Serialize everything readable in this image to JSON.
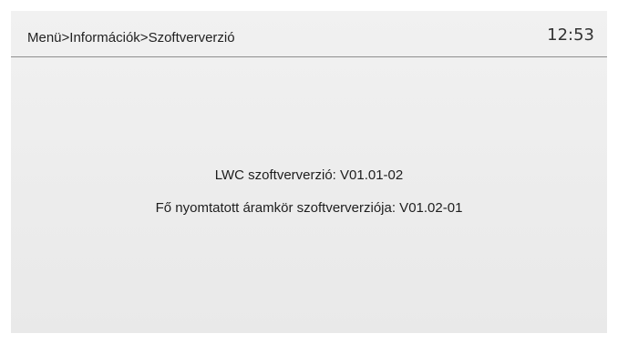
{
  "header": {
    "breadcrumb": "Menü>Információk>Szoftververzió",
    "time": "12:53"
  },
  "main": {
    "lwc_version": "LWC szoftververzió: V01.01-02",
    "pcb_version": "Fő nyomtatott áramkör szoftververziója: V01.02-01"
  }
}
